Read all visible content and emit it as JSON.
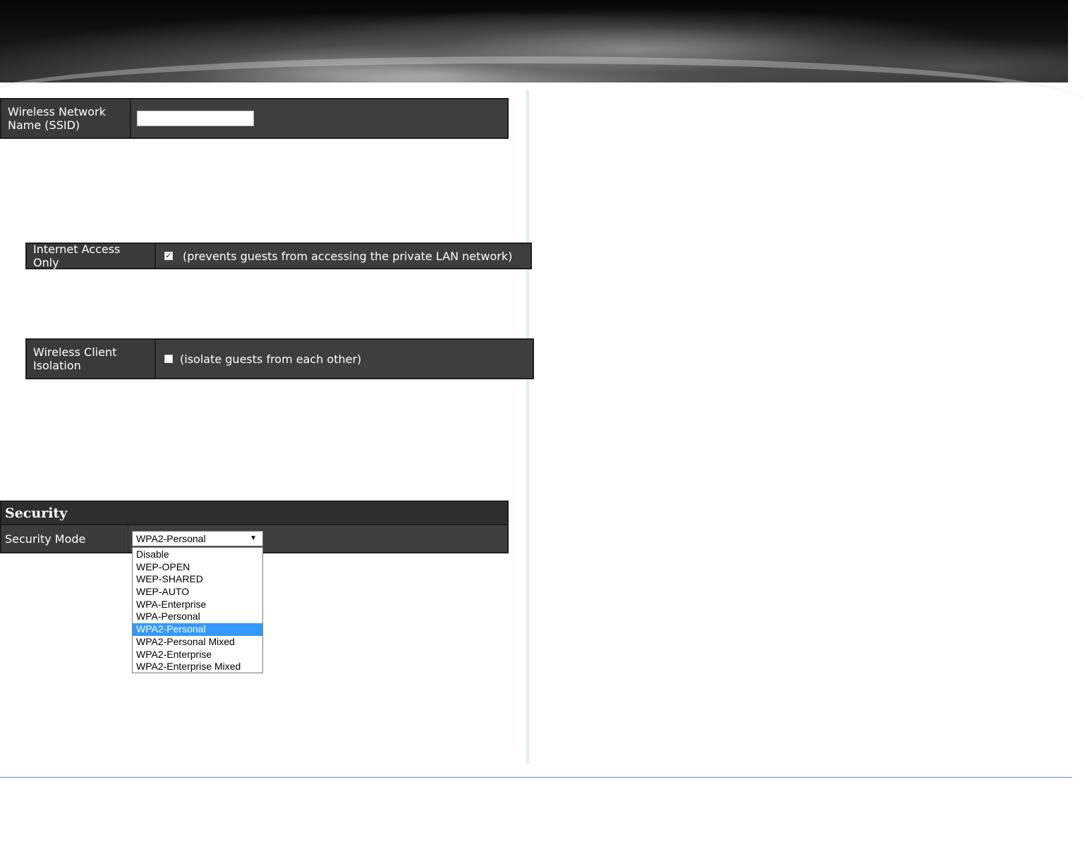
{
  "ssid": {
    "label_line1": "Wireless Network",
    "label_line2": "Name (SSID)",
    "value": ""
  },
  "internet_access_only": {
    "label": "Internet Access Only",
    "checked": true,
    "description": "(prevents guests from accessing the private LAN network)"
  },
  "client_isolation": {
    "label_line1": "Wireless Client",
    "label_line2": "Isolation",
    "checked": false,
    "description": "(isolate guests from each other)"
  },
  "security": {
    "title": "Security",
    "mode_label": "Security Mode",
    "selected": "WPA2-Personal",
    "options": [
      "Disable",
      "WEP-OPEN",
      "WEP-SHARED",
      "WEP-AUTO",
      "WPA-Enterprise",
      "WPA-Personal",
      "WPA2-Personal",
      "WPA2-Personal Mixed",
      "WPA2-Enterprise",
      "WPA2-Enterprise Mixed"
    ]
  },
  "icons": {
    "dropdown_arrow": "▼",
    "checkmark": "✓"
  },
  "colors": {
    "panel_background": "#3c3c3c",
    "selected_option": "#3399ff",
    "bottom_rule": "#5b8fcf"
  }
}
